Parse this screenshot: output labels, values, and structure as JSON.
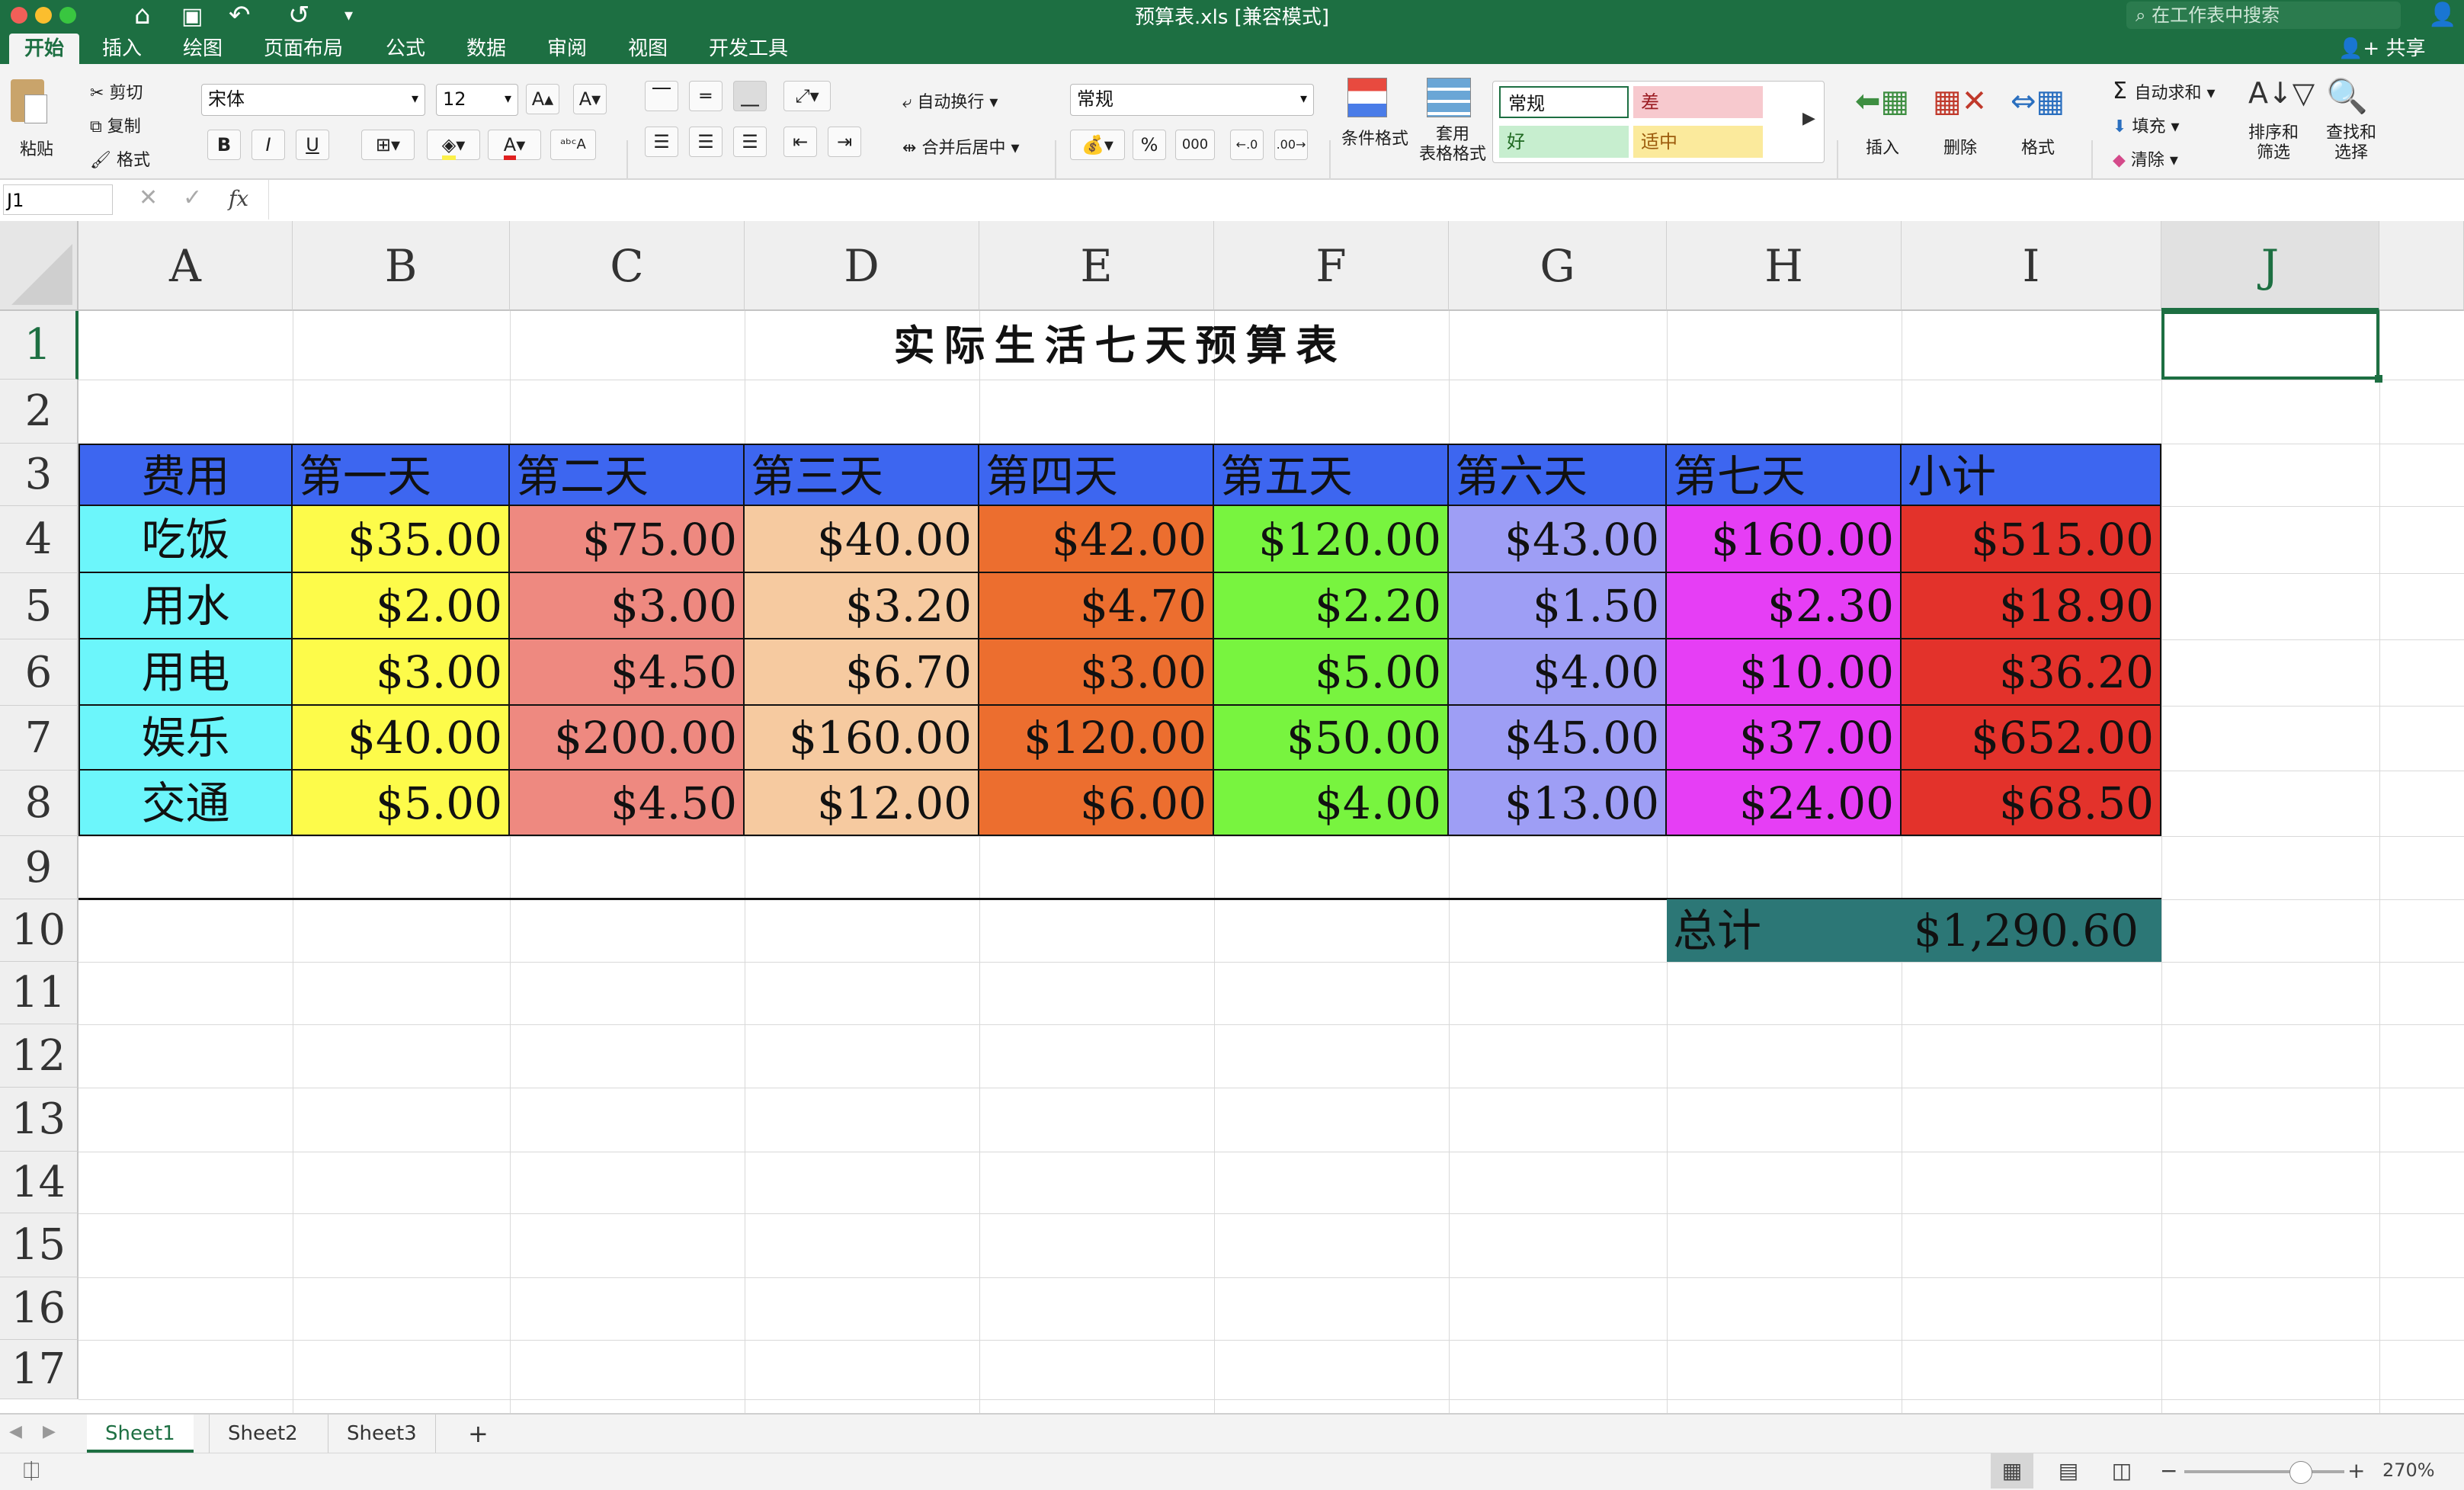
{
  "window": {
    "title": "预算表.xls [兼容模式]",
    "search_placeholder": "在工作表中搜索",
    "share_label": "共享"
  },
  "ribbon_tabs": [
    "开始",
    "插入",
    "绘图",
    "页面布局",
    "公式",
    "数据",
    "审阅",
    "视图",
    "开发工具"
  ],
  "active_tab": "开始",
  "ribbon": {
    "paste_label": "粘贴",
    "cut_label": "剪切",
    "copy_label": "复制",
    "format_painter_label": "格式",
    "font_name": "宋体",
    "font_size": "12",
    "bold": "B",
    "italic": "I",
    "underline": "U",
    "wrap_text_label": "自动换行",
    "merge_center_label": "合并后居中",
    "number_format": "常规",
    "percent": "%",
    "comma": "000",
    "conditional_format_label": "条件格式",
    "format_as_table_label": "套用\n表格格式",
    "styles": {
      "normal": "常规",
      "bad": "差",
      "good": "好",
      "neutral": "适中"
    },
    "insert_label": "插入",
    "delete_label": "删除",
    "format_label": "格式",
    "autosum_label": "自动求和",
    "fill_label": "填充",
    "clear_label": "清除",
    "sort_filter_label": "排序和\n筛选",
    "find_select_label": "查找和\n选择"
  },
  "formula_bar": {
    "name_box": "J1",
    "fx": "fx",
    "content": ""
  },
  "columns": [
    "A",
    "B",
    "C",
    "D",
    "E",
    "F",
    "G",
    "H",
    "I",
    "J"
  ],
  "selected_column": "J",
  "rows": [
    "1",
    "2",
    "3",
    "4",
    "5",
    "6",
    "7",
    "8",
    "9",
    "10",
    "11",
    "12",
    "13",
    "14",
    "15",
    "16",
    "17"
  ],
  "selected_row": "1",
  "sheet": {
    "title": "实际生活七天预算表",
    "headers": [
      "费用",
      "第一天",
      "第二天",
      "第三天",
      "第四天",
      "第五天",
      "第六天",
      "第七天",
      "小计"
    ],
    "data_rows": [
      {
        "category": "吃饭",
        "values": [
          "$35.00",
          "$75.00",
          "$40.00",
          "$42.00",
          "$120.00",
          "$43.00",
          "$160.00",
          "$515.00"
        ]
      },
      {
        "category": "用水",
        "values": [
          "$2.00",
          "$3.00",
          "$3.20",
          "$4.70",
          "$2.20",
          "$1.50",
          "$2.30",
          "$18.90"
        ]
      },
      {
        "category": "用电",
        "values": [
          "$3.00",
          "$4.50",
          "$6.70",
          "$3.00",
          "$5.00",
          "$4.00",
          "$10.00",
          "$36.20"
        ]
      },
      {
        "category": "娱乐",
        "values": [
          "$40.00",
          "$200.00",
          "$160.00",
          "$120.00",
          "$50.00",
          "$45.00",
          "$37.00",
          "$652.00"
        ]
      },
      {
        "category": "交通",
        "values": [
          "$5.00",
          "$4.50",
          "$12.00",
          "$6.00",
          "$4.00",
          "$13.00",
          "$24.00",
          "$68.50"
        ]
      }
    ],
    "total_label": "总计",
    "total_value": "$1,290.60"
  },
  "colors": {
    "header_row": "#3d66f0",
    "category_col": "#6cf6fb",
    "day_cols": [
      "#fdfb4a",
      "#ee8980",
      "#f6caa0",
      "#ec6e2f",
      "#78f43f",
      "#9e9ef5",
      "#e63ef5"
    ],
    "subtotal_col": "#e3322b",
    "total_bg": "#2c7776",
    "brand": "#1d6f42"
  },
  "sheet_tabs": [
    "Sheet1",
    "Sheet2",
    "Sheet3"
  ],
  "active_sheet": "Sheet1",
  "add_sheet": "+",
  "status": {
    "zoom": "270%"
  }
}
